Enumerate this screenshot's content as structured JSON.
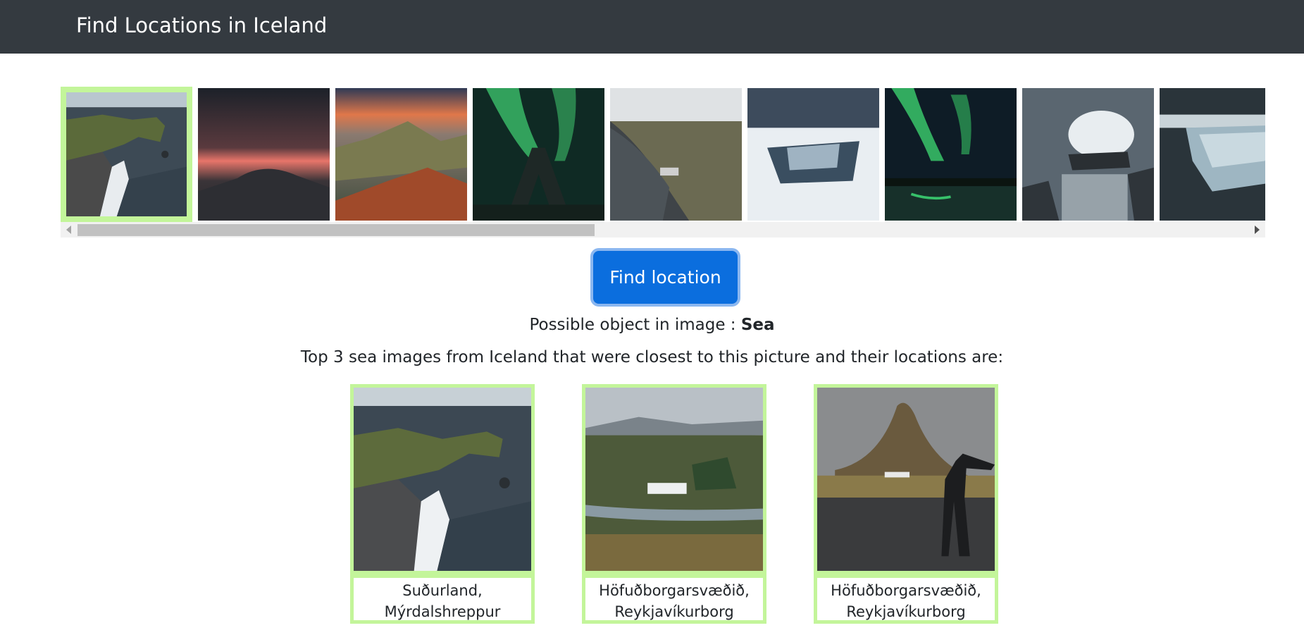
{
  "navbar": {
    "title": "Find Locations in Iceland"
  },
  "gallery": {
    "thumbnails": [
      {
        "name": "sea-cliff-arch",
        "selected": true
      },
      {
        "name": "red-sunset-clouds",
        "selected": false
      },
      {
        "name": "mountain-valley-sunset",
        "selected": false
      },
      {
        "name": "aurora-stone-arch",
        "selected": false
      },
      {
        "name": "black-beach-shipwreck",
        "selected": false
      },
      {
        "name": "frozen-waterfall-canyon",
        "selected": false
      },
      {
        "name": "aurora-lake-forest",
        "selected": false
      },
      {
        "name": "crashing-wave-rock",
        "selected": false
      },
      {
        "name": "glacier-ice",
        "selected": false
      }
    ]
  },
  "actions": {
    "find_label": "Find location"
  },
  "result": {
    "object_prefix": "Possible object in image : ",
    "object_value": "Sea",
    "summary": "Top 3 sea images from Iceland that were closest to this picture and their locations are:"
  },
  "matches": [
    {
      "line1": "Suðurland,",
      "line2": "Mýrdalshreppur"
    },
    {
      "line1": "Höfuðborgarsvæðið,",
      "line2": "Reykjavíkurborg"
    },
    {
      "line1": "Höfuðborgarsvæðið,",
      "line2": "Reykjavíkurborg"
    }
  ],
  "colors": {
    "navbar": "#343a40",
    "selection_border": "#c3f59a",
    "button": "#0b6ede"
  }
}
